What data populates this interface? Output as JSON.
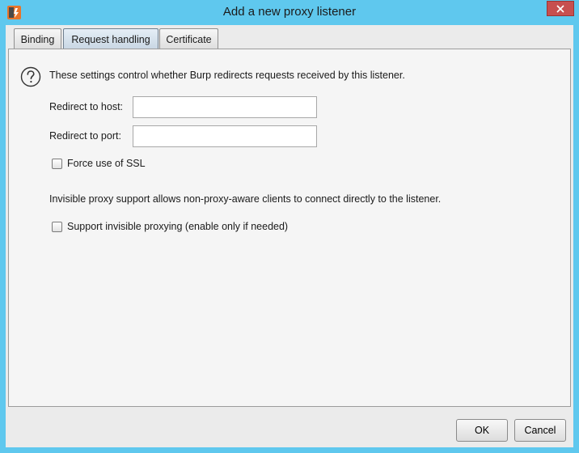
{
  "window": {
    "title": "Add a new proxy listener",
    "app_icon": "burp-app-icon",
    "close_glyph": "✕"
  },
  "tabs": [
    {
      "label": "Binding",
      "active": false
    },
    {
      "label": "Request handling",
      "active": true
    },
    {
      "label": "Certificate",
      "active": false
    }
  ],
  "panel": {
    "description": "These settings control whether Burp redirects requests received by this listener.",
    "redirect_host_label": "Redirect to host:",
    "redirect_host_value": "",
    "redirect_port_label": "Redirect to port:",
    "redirect_port_value": "",
    "force_ssl_label": "Force use of SSL",
    "force_ssl_checked": false,
    "invisible_info": "Invisible proxy support allows non-proxy-aware clients to connect directly to the listener.",
    "invisible_label": "Support invisible proxying (enable only if needed)",
    "invisible_checked": false
  },
  "buttons": {
    "ok": "OK",
    "cancel": "Cancel"
  },
  "colors": {
    "title_bar": "#5fc8ee",
    "close_button": "#c74f4f",
    "app_icon_orange": "#e8742a"
  }
}
